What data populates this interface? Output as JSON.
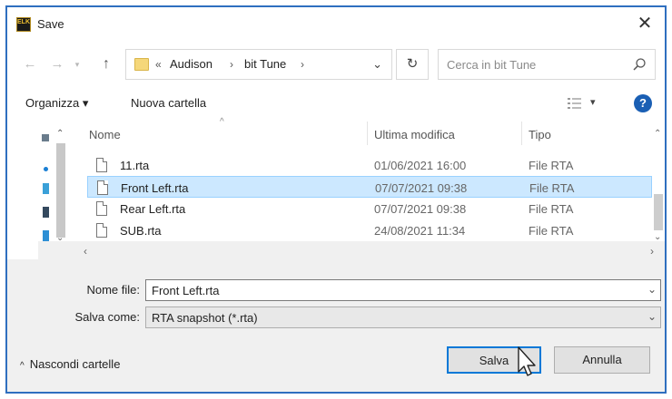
{
  "window": {
    "title": "Save",
    "close_glyph": "✕",
    "icon_text": "ELK"
  },
  "navigation": {
    "back_glyph": "←",
    "forward_glyph": "→",
    "recent_glyph": "▾",
    "up_glyph": "↑",
    "breadcrumb_overflow": "«",
    "breadcrumb": [
      "Audison",
      "bit Tune"
    ],
    "separator": "›",
    "dropdown_glyph": "⌄",
    "refresh_glyph": "↻",
    "search_placeholder": "Cerca in bit Tune"
  },
  "toolbar": {
    "organize_label": "Organizza ▾",
    "new_folder_label": "Nuova cartella",
    "view_dropdown_glyph": "▾",
    "help_glyph": "?"
  },
  "file_list": {
    "columns": {
      "name": "Nome",
      "modified": "Ultima modifica",
      "type": "Tipo"
    },
    "rows": [
      {
        "name": "11.rta",
        "modified": "01/06/2021 16:00",
        "type": "File RTA",
        "selected": false
      },
      {
        "name": "Front Left.rta",
        "modified": "07/07/2021 09:38",
        "type": "File RTA",
        "selected": true
      },
      {
        "name": "Rear Left.rta",
        "modified": "07/07/2021 09:38",
        "type": "File RTA",
        "selected": false
      },
      {
        "name": "SUB.rta",
        "modified": "24/08/2021 11:34",
        "type": "File RTA",
        "selected": false
      }
    ]
  },
  "form": {
    "filename_label": "Nome file:",
    "filename_value": "Front Left.rta",
    "filetype_label": "Salva come:",
    "filetype_value": "RTA snapshot (*.rta)"
  },
  "footer": {
    "hide_folders_label": "Nascondi cartelle",
    "save_label": "Salva",
    "cancel_label": "Annulla"
  },
  "colors": {
    "window_border": "#2f6fbf",
    "selection_bg": "#cce8ff",
    "selection_border": "#99d1ff",
    "default_button_border": "#0078d7",
    "help_icon": "#1a5fb4",
    "folder": "#f5d77a"
  }
}
